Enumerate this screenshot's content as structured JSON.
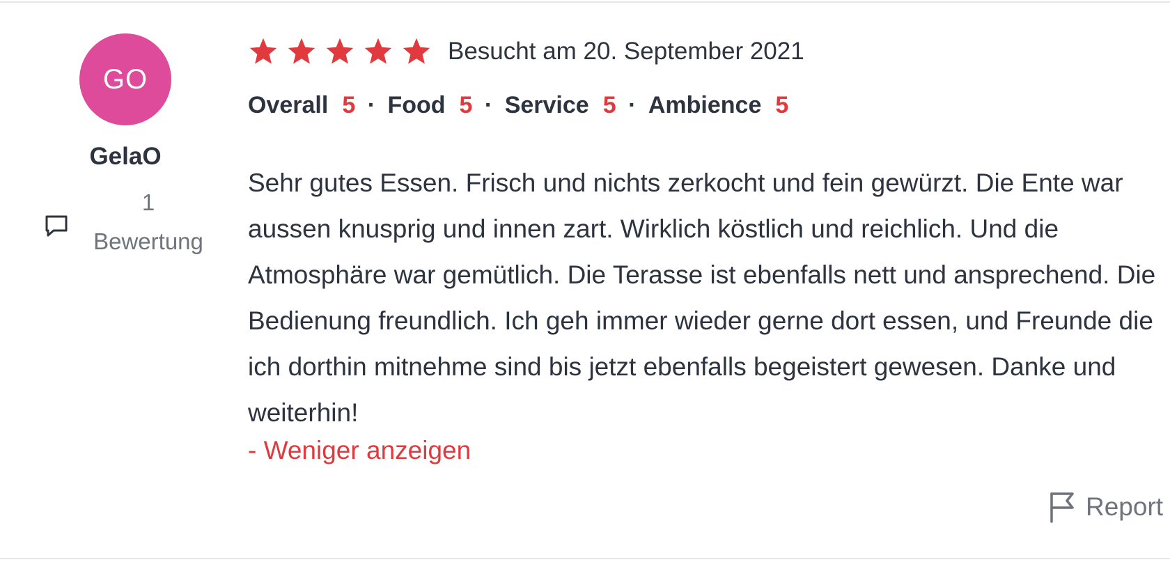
{
  "reviewer": {
    "initials": "GO",
    "avatar_color": "#de4b9a",
    "name": "GelaO",
    "review_count": "1",
    "review_count_label": "Bewertung"
  },
  "review": {
    "star_rating": 5,
    "star_rating_max": 5,
    "star_color": "#e03a3e",
    "visit_date": "Besucht am 20. September 2021",
    "ratings": [
      {
        "label": "Overall",
        "score": "5"
      },
      {
        "label": "Food",
        "score": "5"
      },
      {
        "label": "Service",
        "score": "5"
      },
      {
        "label": "Ambience",
        "score": "5"
      }
    ],
    "separator": "·",
    "score_color": "#e03a3e",
    "text": "Sehr gutes Essen. Frisch und nichts zerkocht und fein gewürzt. Die Ente war aussen knusprig und innen zart. Wirklich köstlich und reichlich. Und die Atmosphäre war gemütlich. Die Terasse ist ebenfalls nett und ansprechend. Die Bedienung freundlich. Ich geh immer wieder gerne dort essen, und Freunde die ich dorthin mitnehme sind bis jetzt ebenfalls begeistert gewesen. Danke und weiterhin!",
    "show_less_label": "- Weniger anzeigen",
    "link_color": "#e03a3e"
  },
  "actions": {
    "report_label": "Report",
    "report_icon": "flag-icon"
  },
  "icons": {
    "review_count_icon": "comment-icon",
    "star_icon": "star-icon"
  }
}
